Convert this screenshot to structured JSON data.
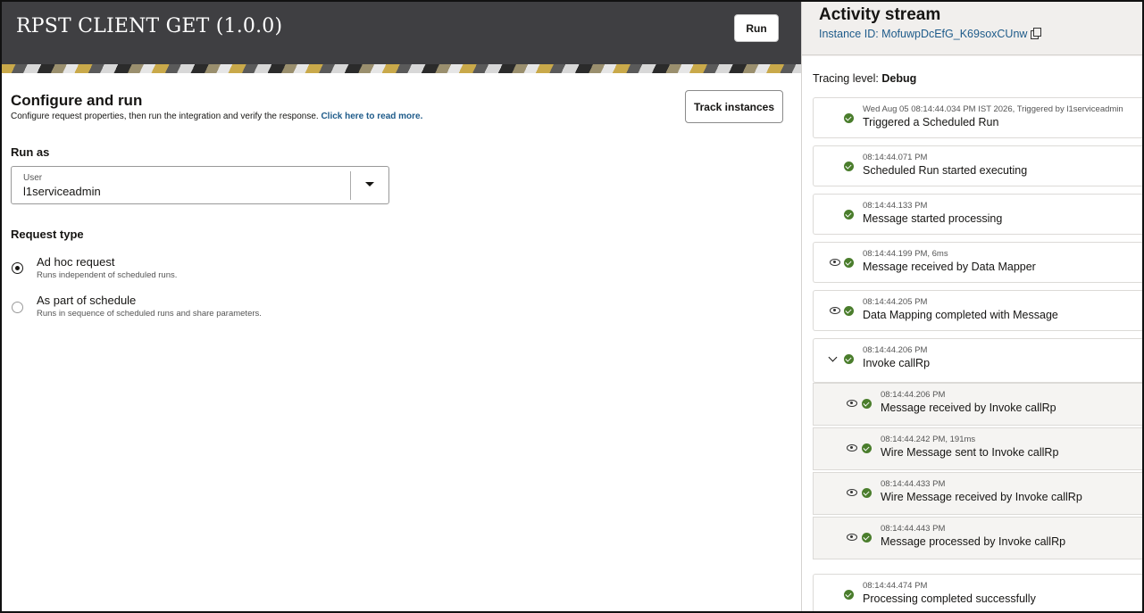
{
  "header": {
    "title": "RPST CLIENT GET (1.0.0)",
    "run_label": "Run"
  },
  "configure": {
    "title": "Configure and run",
    "description": "Configure request properties, then run the integration and verify the response.",
    "link": "Click here to read more.",
    "track_label": "Track instances"
  },
  "run_as": {
    "label": "Run as",
    "field_label": "User",
    "value": "l1serviceadmin"
  },
  "request_type": {
    "label": "Request type",
    "options": [
      {
        "title": "Ad hoc request",
        "sub": "Runs independent of scheduled runs.",
        "selected": true
      },
      {
        "title": "As part of schedule",
        "sub": "Runs in sequence of scheduled runs and share parameters.",
        "selected": false
      }
    ]
  },
  "activity": {
    "title": "Activity stream",
    "instance": "Instance ID: MofuwpDcEfG_K69soxCUnw",
    "tracing_prefix": "Tracing level: ",
    "tracing_value": "Debug",
    "items": [
      {
        "ts": "Wed Aug 05 08:14:44.034 PM IST 2026, Triggered by l1serviceadmin",
        "msg": "Triggered a Scheduled Run",
        "eye": false
      },
      {
        "ts": "08:14:44.071 PM",
        "msg": "Scheduled Run started executing",
        "eye": false
      },
      {
        "ts": "08:14:44.133 PM",
        "msg": "Message started processing",
        "eye": false
      },
      {
        "ts": "08:14:44.199 PM, 6ms",
        "msg": "Message received by Data Mapper",
        "eye": true
      },
      {
        "ts": "08:14:44.205 PM",
        "msg": "Data Mapping completed with Message",
        "eye": true
      },
      {
        "ts": "08:14:44.206 PM",
        "msg": "Invoke callRp",
        "expand": true
      }
    ],
    "sub_items": [
      {
        "ts": "08:14:44.206 PM",
        "msg": "Message received by Invoke callRp"
      },
      {
        "ts": "08:14:44.242 PM, 191ms",
        "msg": "Wire Message sent to Invoke callRp"
      },
      {
        "ts": "08:14:44.433 PM",
        "msg": "Wire Message received by Invoke callRp"
      },
      {
        "ts": "08:14:44.443 PM",
        "msg": "Message processed by Invoke callRp"
      }
    ],
    "final": {
      "ts": "08:14:44.474 PM",
      "msg": "Processing completed successfully"
    }
  }
}
